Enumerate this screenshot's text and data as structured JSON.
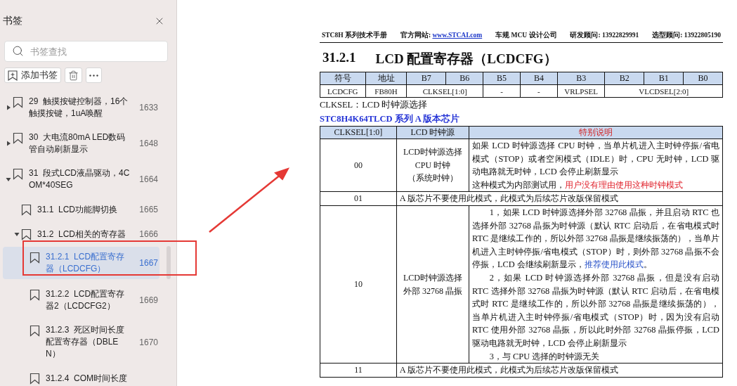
{
  "sidebar": {
    "title": "书签",
    "search": {
      "placeholder": "书签查找"
    },
    "toolbar": {
      "add_label": "添加书签"
    },
    "items": [
      {
        "number": "29",
        "title": "触摸按键控制器，16个触摸按键，1uA唤醒",
        "page": "1633",
        "expanded": false,
        "selected": false
      },
      {
        "number": "30",
        "title": "大电流80mA  LED数码管自动刷新显示",
        "page": "1648",
        "expanded": false,
        "selected": false
      },
      {
        "number": "31",
        "title": "段式LCD液晶驱动，4COM*40SEG",
        "page": "1664",
        "expanded": true,
        "selected": false,
        "children": [
          {
            "number": "31.1",
            "title": "LCD功能脚切换",
            "page": "1665",
            "selected": false
          },
          {
            "number": "31.2",
            "title": "LCD相关的寄存器",
            "page": "1666",
            "expanded": true,
            "selected": false,
            "children": [
              {
                "number": "31.2.1",
                "title": "LCD配置寄存器（LCDCFG）",
                "page": "1667",
                "selected": true
              },
              {
                "number": "31.2.2",
                "title": "LCD配置寄存器2（LCDCFG2）",
                "page": "1669",
                "selected": false
              },
              {
                "number": "31.2.3",
                "title": "死区时间长度配置寄存器（DBLEN）",
                "page": "1670",
                "selected": false
              },
              {
                "number": "31.2.4",
                "title": "COM时间长度",
                "selected": false
              }
            ]
          }
        ]
      }
    ]
  },
  "document": {
    "header": [
      "STC8H 系列技术手册",
      "官方网站: ",
      "车规 MCU 设计公司",
      "研发顾问: 13922829991",
      "选型顾问: 13922805190"
    ],
    "header_link": "www.STCAI.com",
    "heading_number": "31.2.1",
    "heading": "LCD 配置寄存器（LCDCFG）",
    "register_table": {
      "columns": [
        "符号",
        "地址",
        "B7",
        "B6",
        "B5",
        "B4",
        "B3",
        "B2",
        "B1",
        "B0"
      ],
      "row": [
        {
          "text": "LCDCFG"
        },
        {
          "text": "FB80H"
        },
        {
          "text": "CLKSEL[1:0]"
        },
        {
          "merged": true
        },
        {
          "text": "-"
        },
        {
          "text": "-"
        },
        {
          "text": "VRLPSEL"
        },
        {
          "text": "VLCDSEL[2:0]"
        },
        {
          "merged": true
        },
        {
          "merged": true
        }
      ]
    },
    "field_caption": "CLKSEL：LCD 时钟源选择",
    "chip_heading": "STC8H4K64TLCD 系列 A 版本芯片",
    "clock_table": {
      "columns": [
        "CLKSEL[1:0]",
        "LCD 时钟源",
        "特别说明"
      ],
      "rows": [
        {
          "kind": "detail",
          "value": "00",
          "source": [
            "LCD时钟源选择",
            "CPU 时钟",
            "（系统时钟）"
          ],
          "paragraphs": [
            {
              "indent": false,
              "segments": [
                {
                  "text": "如果 LCD 时钟源选择 CPU 时钟，当单片机进入主时钟停振/省电模式（STOP）或者空闲模式（IDLE）时，CPU 无时钟，LCD 驱动电路就无时钟，LCD 会停止刷新显示"
                }
              ]
            },
            {
              "indent": false,
              "segments": [
                {
                  "text": "这种模式为内部测试用，"
                },
                {
                  "text": "用户没有理由使用这种时钟模式",
                  "color": "#e0202a"
                }
              ]
            }
          ]
        },
        {
          "kind": "reserved",
          "value": "01",
          "note": "A 版芯片不要使用此模式，此模式为后续芯片改版保留模式"
        },
        {
          "kind": "detail",
          "value": "10",
          "source": [
            "LCD时钟源选择",
            "外部 32768 晶振"
          ],
          "paragraphs": [
            {
              "indent": true,
              "segments": [
                {
                  "text": "1，如果 LCD 时钟源选择外部 32768 晶振，并且启动 RTC 也选择外部 32768 晶振为时钟源（默认 RTC 启动后，在省电模式时 RTC 是继续工作的，所以外部 32768 晶振是继续振荡的），当单片机进入主时钟停振/省电模式（STOP）时，则外部 32768 晶振不会停振，LCD 会继续刷新显示，"
                },
                {
                  "text": "推荐使用此模式",
                  "color": "#2b54c9"
                },
                {
                  "text": "。"
                }
              ]
            },
            {
              "indent": true,
              "segments": [
                {
                  "text": "2，如果 LCD 时钟源选择外部 32768 晶振，但是没有启动 RTC 选择外部 32768 晶振为时钟源（默认 RTC 启动后，在省电模式时 RTC 是继续工作的，所以外部 32768 晶振是继续振荡的），当单片机进入主时钟停振/省电模式（STOP）时，因为没有启动 RTC 使用外部 32768 晶振，所以此时外部 32768 晶振停振，LCD 驱动电路就无时钟，LCD 会停止刷新显示"
                }
              ]
            },
            {
              "indent": true,
              "segments": [
                {
                  "text": "3，与 CPU 选择的时钟源无关"
                }
              ]
            }
          ]
        },
        {
          "kind": "reserved",
          "value": "11",
          "note": "A 版芯片不要使用此模式，此模式为后续芯片改版保留模式"
        }
      ]
    }
  }
}
